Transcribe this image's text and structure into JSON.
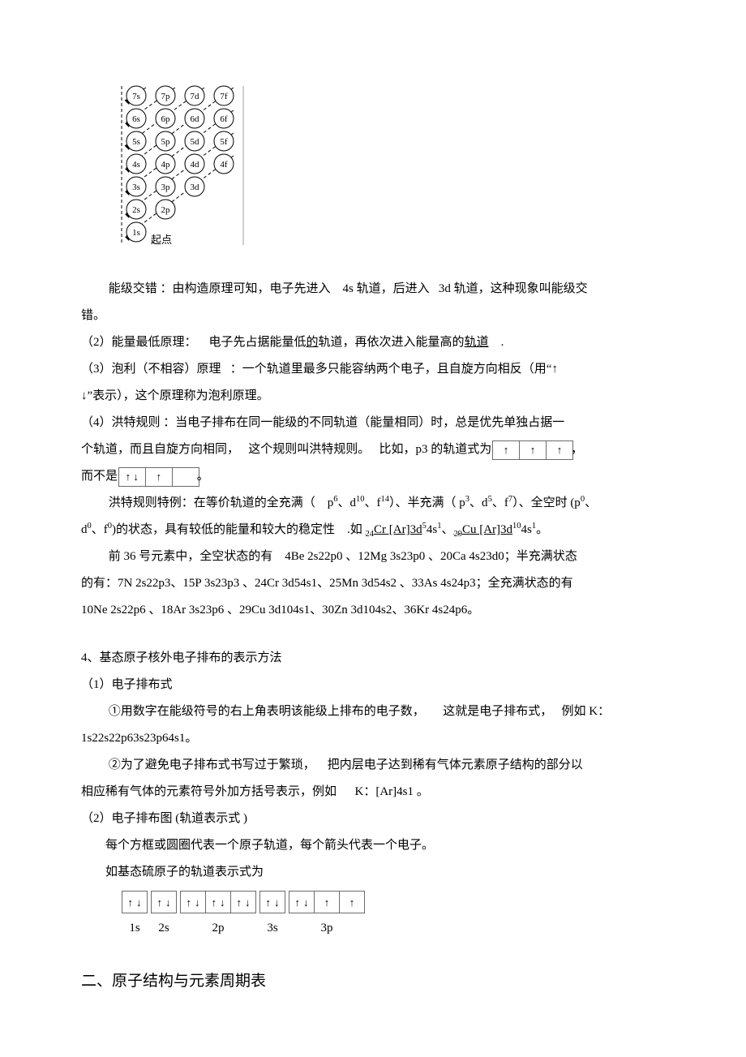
{
  "diagram": {
    "rows": [
      [
        "7s",
        "7p",
        "7d",
        "7f"
      ],
      [
        "6s",
        "6p",
        "6d",
        "6f"
      ],
      [
        "5s",
        "5p",
        "5d",
        "5f"
      ],
      [
        "4s",
        "4p",
        "4d",
        "4f"
      ],
      [
        "3s",
        "3p",
        "3d"
      ],
      [
        "2s",
        "2p"
      ],
      [
        "1s"
      ]
    ],
    "origin_label": "起点"
  },
  "p1": {
    "prefix": "能级交错 ：由构造原理可知，电子先进入",
    "t1": "4s 轨道，后进入",
    "t2": "3d 轨道，这种现象叫能级交",
    "t3": "错。"
  },
  "p2": {
    "a": "（2）能量最低原理：",
    "b": "电子先占据能量低",
    "c": "的",
    "d": "轨道，再依次进入能量高的",
    "e": "轨道",
    "f": "."
  },
  "p3": {
    "a": "（3）泡利（不相容）原理",
    "b": "：一个轨道里最多只能容纳两个电子，且自旋方向相反（用“↑",
    "c": "↓”表示），这个原理称为泡利原理。"
  },
  "p4": {
    "a": "（4）洪特规则 ：当电子排布在同一能级的不同轨道（能量相同）时，总是优先单独占据一",
    "b": "个轨道，而且自旋方向相同，",
    "c": "这个规则叫洪特规则。",
    "d": "比如，p3 的轨道式为",
    "e": "，",
    "f": "而不是",
    "g": "。"
  },
  "p5": {
    "a": "洪特规则特例：在等价轨道的全充满（",
    "b": "p",
    "c": "6",
    "d": "、d",
    "e": "10",
    "f": "、f",
    "g": "14",
    "h": "）、半充满（ p",
    "i": "3",
    "j": "、d",
    "k": "5",
    "l": "、f",
    "m": "7",
    "n": "）、全空时 (p",
    "o": "0",
    "p": "、"
  },
  "p5b": {
    "a": "d",
    "b": "0",
    "c": "、f",
    "d": "0",
    "e": ")的状态，具有较低的能量和较大的稳定性",
    "f": ".如 ",
    "g": "24",
    "h": "Cr [Ar]3d",
    "i": "5",
    "j": "4s",
    "k": "1",
    "l": "、",
    "m": "29",
    "n": "Cu [Ar]3d",
    "o": "10",
    "p": "4s",
    "q": "1",
    "r": "。"
  },
  "p6": {
    "a": "前 36 号元素中，全空状态的有",
    "b": "4Be 2s22p0 、12Mg 3s23p0 、20Ca 4s23d0；半充满状态"
  },
  "p7": "的有：7N 2s22p3、15P 3s23p3 、24Cr 3d54s1、25Mn 3d54s2 、33As 4s24p3；全充满状态的有",
  "p8": "10Ne 2s22p6 、18Ar 3s23p6 、29Cu 3d104s1、30Zn 3d104s2、36Kr 4s24p6。",
  "s4_title": "4、基态原子核外电子排布的表示方法",
  "s4_1": "（1）电子排布式",
  "s4_1a": {
    "a": "①用数字在能级符号的右上角表明该能级上排布的电子数，",
    "b": "这就是电子排布式，",
    "c": "例如 K："
  },
  "s4_1b": "1s22s22p63s23p64s1。",
  "s4_1c": {
    "a": "②为了避免电子排布式书写过于繁琐，",
    "b": "把内层电子达到稀有气体元素原子结构的部分以"
  },
  "s4_1d": {
    "a": "相应稀有气体的元素符号外加方括号表示，例如",
    "b": "K：[Ar]4s1 。"
  },
  "s4_2": "（2）电子排布图 (轨道表示式 )",
  "s4_2a": "每个方框或圆圈代表一个原子轨道，每个箭头代表一个电子。",
  "s4_2b": "如基态硫原子的轨道表示式为",
  "orbital_box": {
    "groups": [
      {
        "label": "1s",
        "cells": [
          [
            "↑",
            "↓"
          ]
        ]
      },
      {
        "label": "2s",
        "cells": [
          [
            "↑",
            "↓"
          ]
        ]
      },
      {
        "label": "2p",
        "cells": [
          [
            "↑",
            "↓"
          ],
          [
            "↑",
            "↓"
          ],
          [
            "↑",
            "↓"
          ]
        ]
      },
      {
        "label": "3s",
        "cells": [
          [
            "↑",
            "↓"
          ]
        ]
      },
      {
        "label": "3p",
        "cells": [
          [
            "↑",
            "↓"
          ],
          [
            "↑",
            ""
          ],
          [
            "↑",
            ""
          ]
        ]
      }
    ]
  },
  "sec2": "二、原子结构与元素周期表"
}
